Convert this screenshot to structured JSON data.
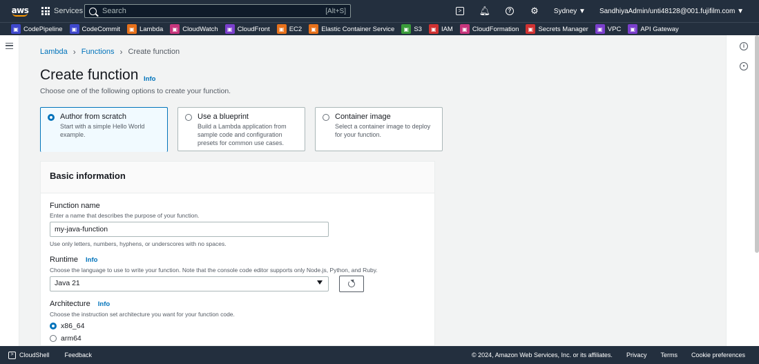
{
  "topnav": {
    "logo": "aws",
    "services_label": "Services",
    "search_placeholder": "Search",
    "search_shortcut": "[Alt+S]",
    "region": "Sydney ▼",
    "account": "SandhiyaAdmin/unti48128@001.fujifilm.com ▼"
  },
  "favorites": [
    {
      "label": "CodePipeline",
      "color": "#3f48cc",
      "icon": "pipeline-icon"
    },
    {
      "label": "CodeCommit",
      "color": "#3f48cc",
      "icon": "commit-icon"
    },
    {
      "label": "Lambda",
      "color": "#e7711b",
      "icon": "lambda-icon"
    },
    {
      "label": "CloudWatch",
      "color": "#c7357c",
      "icon": "cloudwatch-icon"
    },
    {
      "label": "CloudFront",
      "color": "#7b3fcc",
      "icon": "cloudfront-icon"
    },
    {
      "label": "EC2",
      "color": "#e7711b",
      "icon": "ec2-icon"
    },
    {
      "label": "Elastic Container Service",
      "color": "#e7711b",
      "icon": "ecs-icon"
    },
    {
      "label": "S3",
      "color": "#3a9b3a",
      "icon": "s3-icon"
    },
    {
      "label": "IAM",
      "color": "#d13232",
      "icon": "iam-icon"
    },
    {
      "label": "CloudFormation",
      "color": "#c7357c",
      "icon": "cloudformation-icon"
    },
    {
      "label": "Secrets Manager",
      "color": "#d13232",
      "icon": "secrets-icon"
    },
    {
      "label": "VPC",
      "color": "#7b3fcc",
      "icon": "vpc-icon"
    },
    {
      "label": "API Gateway",
      "color": "#7b3fcc",
      "icon": "api-gateway-icon"
    }
  ],
  "breadcrumb": {
    "lambda": "Lambda",
    "functions": "Functions",
    "current": "Create function"
  },
  "page": {
    "title": "Create function",
    "info": "Info",
    "subtitle": "Choose one of the following options to create your function."
  },
  "options": [
    {
      "label": "Author from scratch",
      "desc": "Start with a simple Hello World example.",
      "selected": true
    },
    {
      "label": "Use a blueprint",
      "desc": "Build a Lambda application from sample code and configuration presets for common use cases.",
      "selected": false
    },
    {
      "label": "Container image",
      "desc": "Select a container image to deploy for your function.",
      "selected": false
    }
  ],
  "basic": {
    "heading": "Basic information",
    "fn_label": "Function name",
    "fn_desc": "Enter a name that describes the purpose of your function.",
    "fn_value": "my-java-function",
    "fn_hint": "Use only letters, numbers, hyphens, or underscores with no spaces.",
    "runtime_label": "Runtime",
    "runtime_info": "Info",
    "runtime_desc": "Choose the language to use to write your function. Note that the console code editor supports only Node.js, Python, and Ruby.",
    "runtime_value": "Java 21",
    "arch_label": "Architecture",
    "arch_info": "Info",
    "arch_desc": "Choose the instruction set architecture you want for your function code.",
    "arch_options": [
      "x86_64",
      "arm64"
    ],
    "arch_selected": 0
  },
  "footer": {
    "cloudshell": "CloudShell",
    "feedback": "Feedback",
    "copyright": "© 2024, Amazon Web Services, Inc. or its affiliates.",
    "privacy": "Privacy",
    "terms": "Terms",
    "cookies": "Cookie preferences"
  }
}
